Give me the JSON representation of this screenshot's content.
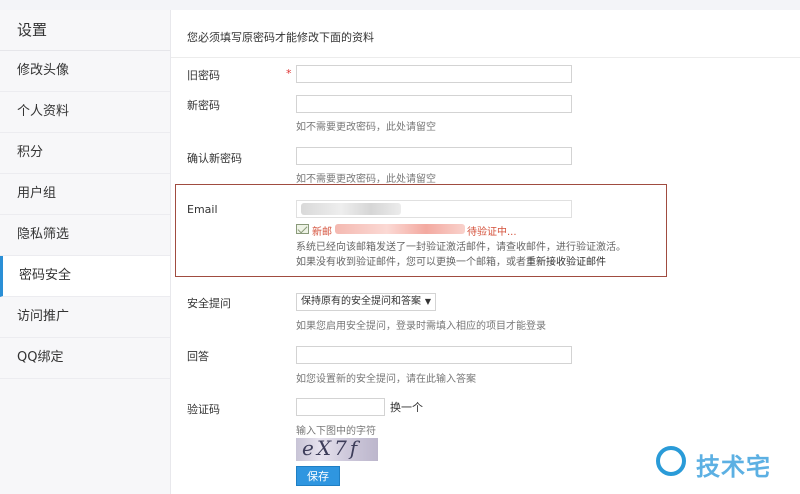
{
  "sidebar": {
    "title": "设置",
    "items": [
      {
        "label": "修改头像"
      },
      {
        "label": "个人资料"
      },
      {
        "label": "积分"
      },
      {
        "label": "用户组"
      },
      {
        "label": "隐私筛选"
      },
      {
        "label": "密码安全",
        "active": true
      },
      {
        "label": "访问推广"
      },
      {
        "label": "QQ绑定"
      }
    ]
  },
  "form": {
    "notice": "您必须填写原密码才能修改下面的资料",
    "old_password": {
      "label": "旧密码",
      "required": "*"
    },
    "new_password": {
      "label": "新密码",
      "hint": "如不需要更改密码，此处请留空"
    },
    "confirm_password": {
      "label": "确认新密码",
      "hint": "如不需要更改密码，此处请留空"
    },
    "email": {
      "label": "Email",
      "new_email_prefix": "新邮",
      "pending_suffix": "待验证中...",
      "text1": "系统已经向该邮箱发送了一封验证激活邮件，请查收邮件，进行验证激活。",
      "text2": "如果没有收到验证邮件，您可以更换一个邮箱，或者",
      "resend_link": "重新接收验证邮件"
    },
    "security_question": {
      "label": "安全提问",
      "selected": "保持原有的安全提问和答案",
      "hint": "如果您启用安全提问，登录时需填入相应的项目才能登录"
    },
    "answer": {
      "label": "回答",
      "hint": "如您设置新的安全提问，请在此输入答案"
    },
    "captcha": {
      "label": "验证码",
      "change": "换一个",
      "hint": "输入下图中的字符",
      "image_text": "eX7f"
    },
    "save_label": "保存"
  },
  "watermark": {
    "text": "技术宅"
  },
  "colors": {
    "accent": "#2a8fd6",
    "email_border": "#a04c40",
    "required": "#dd3333"
  }
}
